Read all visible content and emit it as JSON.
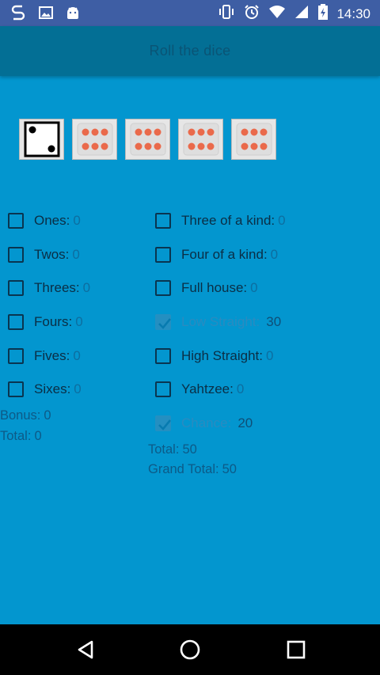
{
  "status_bar": {
    "time": "14:30",
    "icons": [
      "s-app-icon",
      "gallery-icon",
      "android-icon",
      "vibrate-icon",
      "alarm-icon",
      "wifi-icon",
      "signal-icon",
      "battery-charging-icon"
    ]
  },
  "toolbar": {
    "title": "Roll the dice"
  },
  "dice": [
    {
      "face": 2,
      "held": false
    },
    {
      "face": 6,
      "held": true
    },
    {
      "face": 6,
      "held": true
    },
    {
      "face": 6,
      "held": true
    },
    {
      "face": 6,
      "held": true
    }
  ],
  "upper_section": [
    {
      "label": "Ones:",
      "value": "0",
      "checked": false,
      "enabled": true
    },
    {
      "label": "Twos:",
      "value": "0",
      "checked": false,
      "enabled": true
    },
    {
      "label": "Threes:",
      "value": "0",
      "checked": false,
      "enabled": true
    },
    {
      "label": "Fours:",
      "value": "0",
      "checked": false,
      "enabled": true
    },
    {
      "label": "Fives:",
      "value": "0",
      "checked": false,
      "enabled": true
    },
    {
      "label": "Sixes:",
      "value": "0",
      "checked": false,
      "enabled": true
    }
  ],
  "upper_summary": {
    "bonus_label": "Bonus:",
    "bonus_value": "0",
    "total_label": "Total:",
    "total_value": "0"
  },
  "lower_section": [
    {
      "label": "Three of a kind:",
      "value": "0",
      "checked": false,
      "enabled": true
    },
    {
      "label": "Four of a kind:",
      "value": "0",
      "checked": false,
      "enabled": true
    },
    {
      "label": "Full house:",
      "value": "0",
      "checked": false,
      "enabled": true
    },
    {
      "label": "Low Straight:",
      "value": "30",
      "checked": true,
      "enabled": false
    },
    {
      "label": "High Straight:",
      "value": "0",
      "checked": false,
      "enabled": true
    },
    {
      "label": "Yahtzee:",
      "value": "0",
      "checked": false,
      "enabled": true
    },
    {
      "label": "Chance:",
      "value": "20",
      "checked": true,
      "enabled": false
    }
  ],
  "lower_summary": {
    "total_label": "Total:",
    "total_value": "50",
    "grand_total_label": "Grand Total:",
    "grand_total_value": "50"
  },
  "colors": {
    "background": "#0396cf",
    "toolbar": "#036f95",
    "status_bar": "#3e5ea4",
    "pip_held": "#ea6a4b",
    "pip_normal": "#000000"
  }
}
